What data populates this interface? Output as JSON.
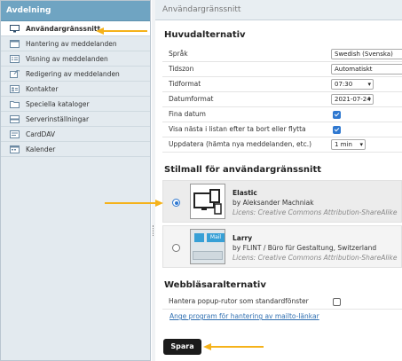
{
  "sidebar": {
    "title": "Avdelning",
    "items": [
      {
        "label": "Användargränssnitt",
        "icon": "monitor-icon"
      },
      {
        "label": "Hantering av meddelanden",
        "icon": "window-icon"
      },
      {
        "label": "Visning av meddelanden",
        "icon": "list-window-icon"
      },
      {
        "label": "Redigering av meddelanden",
        "icon": "compose-icon"
      },
      {
        "label": "Kontakter",
        "icon": "contact-card-icon"
      },
      {
        "label": "Speciella kataloger",
        "icon": "folder-icon"
      },
      {
        "label": "Serverinställningar",
        "icon": "server-icon"
      },
      {
        "label": "CardDAV",
        "icon": "carddav-icon"
      },
      {
        "label": "Kalender",
        "icon": "calendar-icon"
      }
    ]
  },
  "main": {
    "header": "Användargränssnitt",
    "section_main": "Huvudalternativ",
    "rows": {
      "language": {
        "label": "Språk",
        "value": "Swedish (Svenska)"
      },
      "timezone": {
        "label": "Tidszon",
        "value": "Automatiskt"
      },
      "time_format": {
        "label": "Tidformat",
        "value": "07:30"
      },
      "date_format": {
        "label": "Datumformat",
        "value": "2021-07-24"
      },
      "pretty_date": {
        "label": "Fina datum",
        "checked": true
      },
      "show_next": {
        "label": "Visa nästa i listan efter ta bort eller flytta",
        "checked": true
      },
      "refresh": {
        "label": "Uppdatera (hämta nya meddelanden, etc.)",
        "value": "1 min"
      }
    },
    "section_skin": "Stilmall för användargränssnitt",
    "skins": [
      {
        "name": "Elastic",
        "author": "by Aleksander Machniak",
        "license": "Licens: Creative Commons Attribution-ShareAlike",
        "selected": true
      },
      {
        "name": "Larry",
        "author": "by FLINT / Büro für Gestaltung, Switzerland",
        "license": "Licens: Creative Commons Attribution-ShareAlike",
        "selected": false,
        "thumb_text": "Mail"
      }
    ],
    "section_browser": "Webbläsaralternativ",
    "popup_label": "Hantera popup-rutor som standardfönster",
    "popup_checked": false,
    "mailto_link": "Ange program för hantering av mailto-länkar",
    "save_label": "Spara"
  },
  "colors": {
    "sidebar_header": "#6fa4c2",
    "accent": "#2f78d0",
    "annotation_arrow": "#f5b21a"
  }
}
